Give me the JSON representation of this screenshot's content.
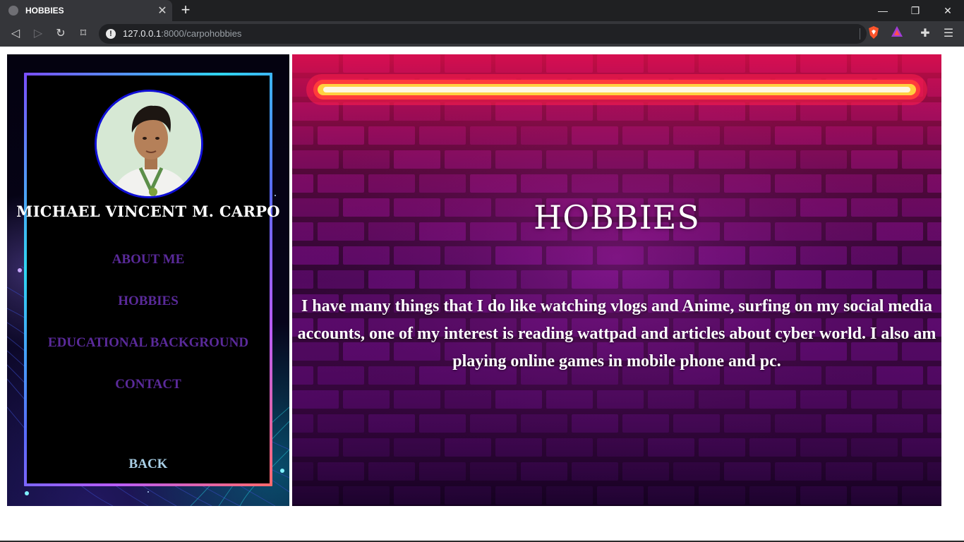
{
  "browser": {
    "tab_title": "HOBBIES",
    "url_host": "127.0.0.1",
    "url_rest": ":8000/carpohobbies",
    "icons": {
      "favicon": "globe-icon",
      "tab_close": "close-icon",
      "new_tab": "plus-icon",
      "back": "back-arrow-icon",
      "forward": "forward-arrow-icon",
      "reload": "reload-icon",
      "bookmark": "bookmark-icon",
      "site_info": "info-icon",
      "brave_shield": "brave-shield-icon",
      "brave_rewards": "brave-rewards-icon",
      "extensions": "puzzle-icon",
      "menu": "hamburger-menu-icon"
    }
  },
  "sidebar": {
    "name": "MICHAEL VINCENT M. CARPO",
    "avatar": "profile-photo",
    "links": [
      {
        "label": "ABOUT ME"
      },
      {
        "label": "HOBBIES"
      },
      {
        "label": "EDUCATIONAL BACKGROUND"
      },
      {
        "label": "CONTACT"
      }
    ],
    "back_label": "BACK"
  },
  "main": {
    "heading": "HOBBIES",
    "text": "I have many things that I do like watching vlogs and Anime, surfing on my social media accounts, one of my interest is reading wattpad and articles about cyber world. I also am playing online games in mobile phone and pc."
  },
  "colors": {
    "link": "#5a2a9a",
    "back": "#a9cfe6",
    "neon": "#ff2a55",
    "avatar_border": "#1010d8"
  }
}
